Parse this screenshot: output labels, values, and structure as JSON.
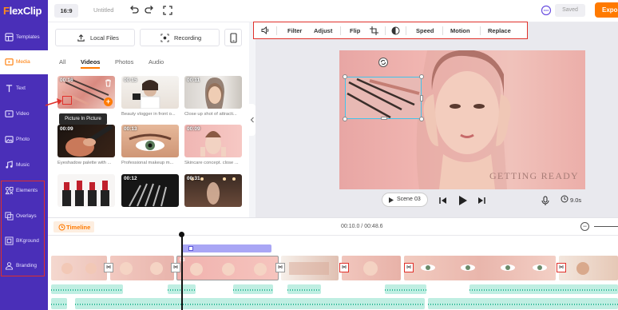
{
  "app": {
    "logo_fx": "F",
    "logo_rest": "lexClip"
  },
  "sidebar": {
    "items": [
      {
        "label": "Templates",
        "icon": "templates-icon"
      },
      {
        "label": "Media",
        "icon": "media-icon"
      },
      {
        "label": "Text",
        "icon": "text-icon"
      },
      {
        "label": "Video",
        "icon": "video-icon"
      },
      {
        "label": "Photo",
        "icon": "photo-icon"
      },
      {
        "label": "Music",
        "icon": "music-icon"
      },
      {
        "label": "Elements",
        "icon": "elements-icon"
      },
      {
        "label": "Overlays",
        "icon": "overlays-icon"
      },
      {
        "label": "BKground",
        "icon": "background-icon"
      },
      {
        "label": "Branding",
        "icon": "branding-icon"
      }
    ]
  },
  "topbar": {
    "aspect_ratio": "16:9",
    "project_title": "Untitled",
    "saved_label": "Saved",
    "export_label": "Expor"
  },
  "media": {
    "local_files_label": "Local Files",
    "recording_label": "Recording",
    "tabs": [
      "All",
      "Videos",
      "Photos",
      "Audio"
    ],
    "active_tab": "Videos",
    "tooltip": "Picture In Picture",
    "items": [
      {
        "duration": "00:16",
        "caption": ""
      },
      {
        "duration": "00:15",
        "caption": "Beauty vlogger in front o..."
      },
      {
        "duration": "00:11",
        "caption": "Close up shot of attracti..."
      },
      {
        "duration": "00:09",
        "caption": "Eyeshadow palette with ..."
      },
      {
        "duration": "00:13",
        "caption": "Professional makeup m..."
      },
      {
        "duration": "00:09",
        "caption": "Skincare concept. close ..."
      },
      {
        "duration": "",
        "caption": ""
      },
      {
        "duration": "00:12",
        "caption": ""
      },
      {
        "duration": "00:31",
        "caption": ""
      }
    ]
  },
  "edit_toolbar": {
    "tools": [
      "Filter",
      "Adjust",
      "Flip",
      "Speed",
      "Motion",
      "Replace"
    ]
  },
  "preview": {
    "overlay_text": "GETTING READY",
    "scene_label": "Scene",
    "scene_number": "03",
    "duration": "9.0s"
  },
  "timeline": {
    "label": "Timeline",
    "current_time": "00:10.0",
    "total_time": "00:48.6",
    "clip_labels": [
      "03"
    ]
  },
  "colors": {
    "sidebar_bg": "#4a2fb8",
    "accent": "#ff7a00",
    "highlight_box": "#e0302a",
    "selection": "#43c3ea",
    "audio_track": "#bfeee2"
  }
}
